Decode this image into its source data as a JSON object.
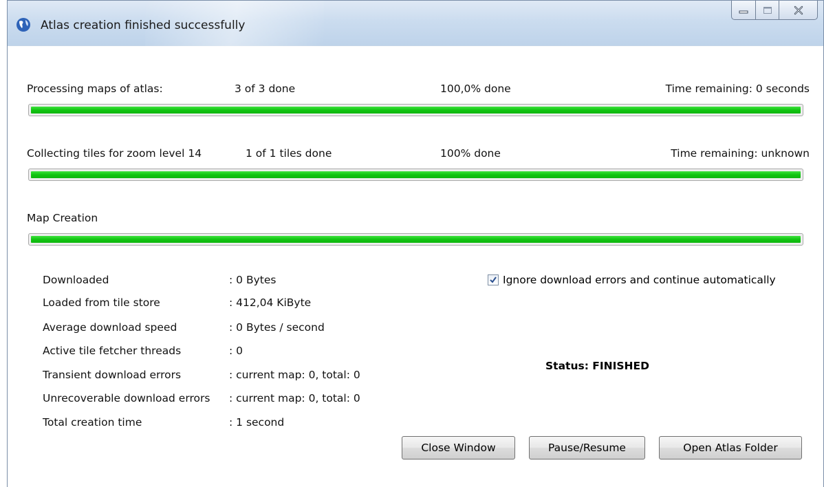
{
  "window": {
    "title": "Atlas creation finished successfully"
  },
  "progress": [
    {
      "label": "Processing maps of atlas:",
      "count": "3 of 3 done",
      "percent_text": "100,0% done",
      "remaining": "Time remaining: 0 seconds",
      "fraction": 1.0
    },
    {
      "label": "Collecting tiles for zoom level 14",
      "count": "1 of 1 tiles done",
      "percent_text": "100% done",
      "remaining": "Time remaining: unknown",
      "fraction": 1.0
    },
    {
      "label": "Map Creation",
      "fraction": 1.0
    }
  ],
  "stats": [
    {
      "label": "Downloaded",
      "value": ": 0 Bytes"
    },
    {
      "label": "Loaded from tile store",
      "value": ": 412,04 KiByte"
    },
    {
      "label": "Average download speed",
      "value": ": 0 Bytes / second"
    },
    {
      "label": "Active tile fetcher threads",
      "value": ": 0"
    },
    {
      "label": "Transient download errors",
      "value": ": current map: 0, total: 0"
    },
    {
      "label": "Unrecoverable download errors",
      "value": ": current map: 0, total: 0"
    },
    {
      "label": "Total creation time",
      "value": ": 1 second"
    }
  ],
  "options": {
    "ignore_errors_label": "Ignore download errors and continue automatically",
    "ignore_errors_checked": true
  },
  "status_text": "Status: FINISHED",
  "buttons": {
    "close": "Close Window",
    "pause": "Pause/Resume",
    "open_folder": "Open Atlas Folder"
  },
  "colors": {
    "progress_fill": "#11c511",
    "titlebar": "#cbdcef"
  }
}
